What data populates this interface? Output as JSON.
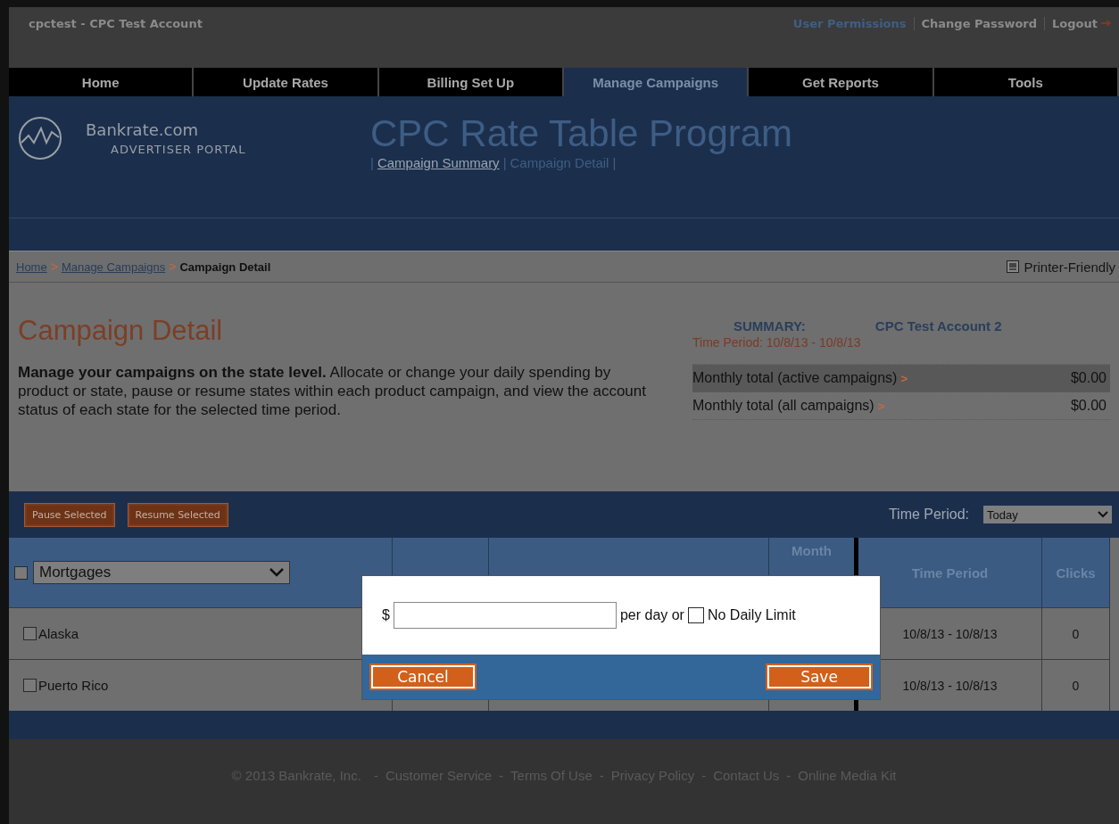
{
  "account": "cpctest - CPC Test Account",
  "top_links": [
    {
      "label": "User Permissions",
      "selected": true
    },
    {
      "label": "Change Password",
      "selected": false
    },
    {
      "label": "Logout",
      "selected": false
    }
  ],
  "nav": [
    {
      "label": "Home",
      "selected": false
    },
    {
      "label": "Update Rates",
      "selected": false
    },
    {
      "label": "Billing Set Up",
      "selected": false
    },
    {
      "label": "Manage Campaigns",
      "selected": true
    },
    {
      "label": "Get Reports",
      "selected": false
    },
    {
      "label": "Tools",
      "selected": false
    }
  ],
  "brand": {
    "name": "Bankrate.com",
    "tagline": "ADVERTISER PORTAL"
  },
  "program": {
    "title": "CPC Rate Table Program",
    "items": [
      {
        "text": "|",
        "kind": "separator"
      },
      {
        "text": "Campaign Summary",
        "kind": "link"
      },
      {
        "text": "|",
        "kind": "separator"
      },
      {
        "text": "Campaign Detail",
        "kind": "current"
      },
      {
        "text": "|",
        "kind": "separator"
      }
    ]
  },
  "breadcrumb": [
    {
      "text": "Home",
      "kind": "link"
    },
    {
      "text": ">",
      "kind": "separator"
    },
    {
      "text": "Manage Campaigns",
      "kind": "link"
    },
    {
      "text": ">",
      "kind": "separator"
    },
    {
      "text": "Campaign Detail",
      "kind": "current"
    }
  ],
  "printer": "Printer-Friendly",
  "page": {
    "title": "Campaign Detail",
    "intro": "**Manage your campaigns on the state level.** Allocate or change your daily spending by product or state, pause or resume states within each product campaign, and view the account status of each state for the selected time period."
  },
  "summary": {
    "label": "SUMMARY:",
    "account": "CPC Test Account 2",
    "time_period": "Time Period: 10/8/13 - 10/8/13",
    "totals": [
      {
        "label": "Monthly total (active campaigns)",
        "arrow": ">",
        "amount": "$0.00",
        "highlighted": true
      },
      {
        "label": "Monthly total (all campaigns)",
        "arrow": ">",
        "amount": "$0.00",
        "highlighted": false
      }
    ]
  },
  "toolbar": {
    "buttons": [
      "Pause Selected",
      "Resume Selected"
    ],
    "time_period_label": "Time Period:",
    "time_period_value": "Today"
  },
  "table": {
    "product": "Mortgages",
    "select_all_checked": false,
    "columns": [
      "Month",
      "Time Period",
      "Clicks"
    ],
    "rows": [
      {
        "state": "Alaska",
        "checked": false,
        "time_period": "10/8/13 - 10/8/13",
        "clicks": "0"
      },
      {
        "state": "Puerto Rico",
        "checked": false,
        "time_period": "10/8/13 - 10/8/13",
        "clicks": "0"
      }
    ]
  },
  "dialog": {
    "currency": "$",
    "per_day": "per day or",
    "no_limit_label": "No Daily Limit",
    "no_limit_checked": false,
    "buttons": [
      "Cancel",
      "Save"
    ]
  },
  "footer": [
    {
      "text": "© 2013 Bankrate, Inc.",
      "kind": "text"
    },
    {
      "text": "-",
      "kind": "separator"
    },
    {
      "text": "Customer Service",
      "kind": "link"
    },
    {
      "text": "-",
      "kind": "separator"
    },
    {
      "text": "Terms Of Use",
      "kind": "link"
    },
    {
      "text": "-",
      "kind": "separator"
    },
    {
      "text": "Privacy Policy",
      "kind": "link"
    },
    {
      "text": "-",
      "kind": "separator"
    },
    {
      "text": "Contact Us",
      "kind": "link"
    },
    {
      "text": "-",
      "kind": "separator"
    },
    {
      "text": "Online Media Kit",
      "kind": "link"
    }
  ]
}
